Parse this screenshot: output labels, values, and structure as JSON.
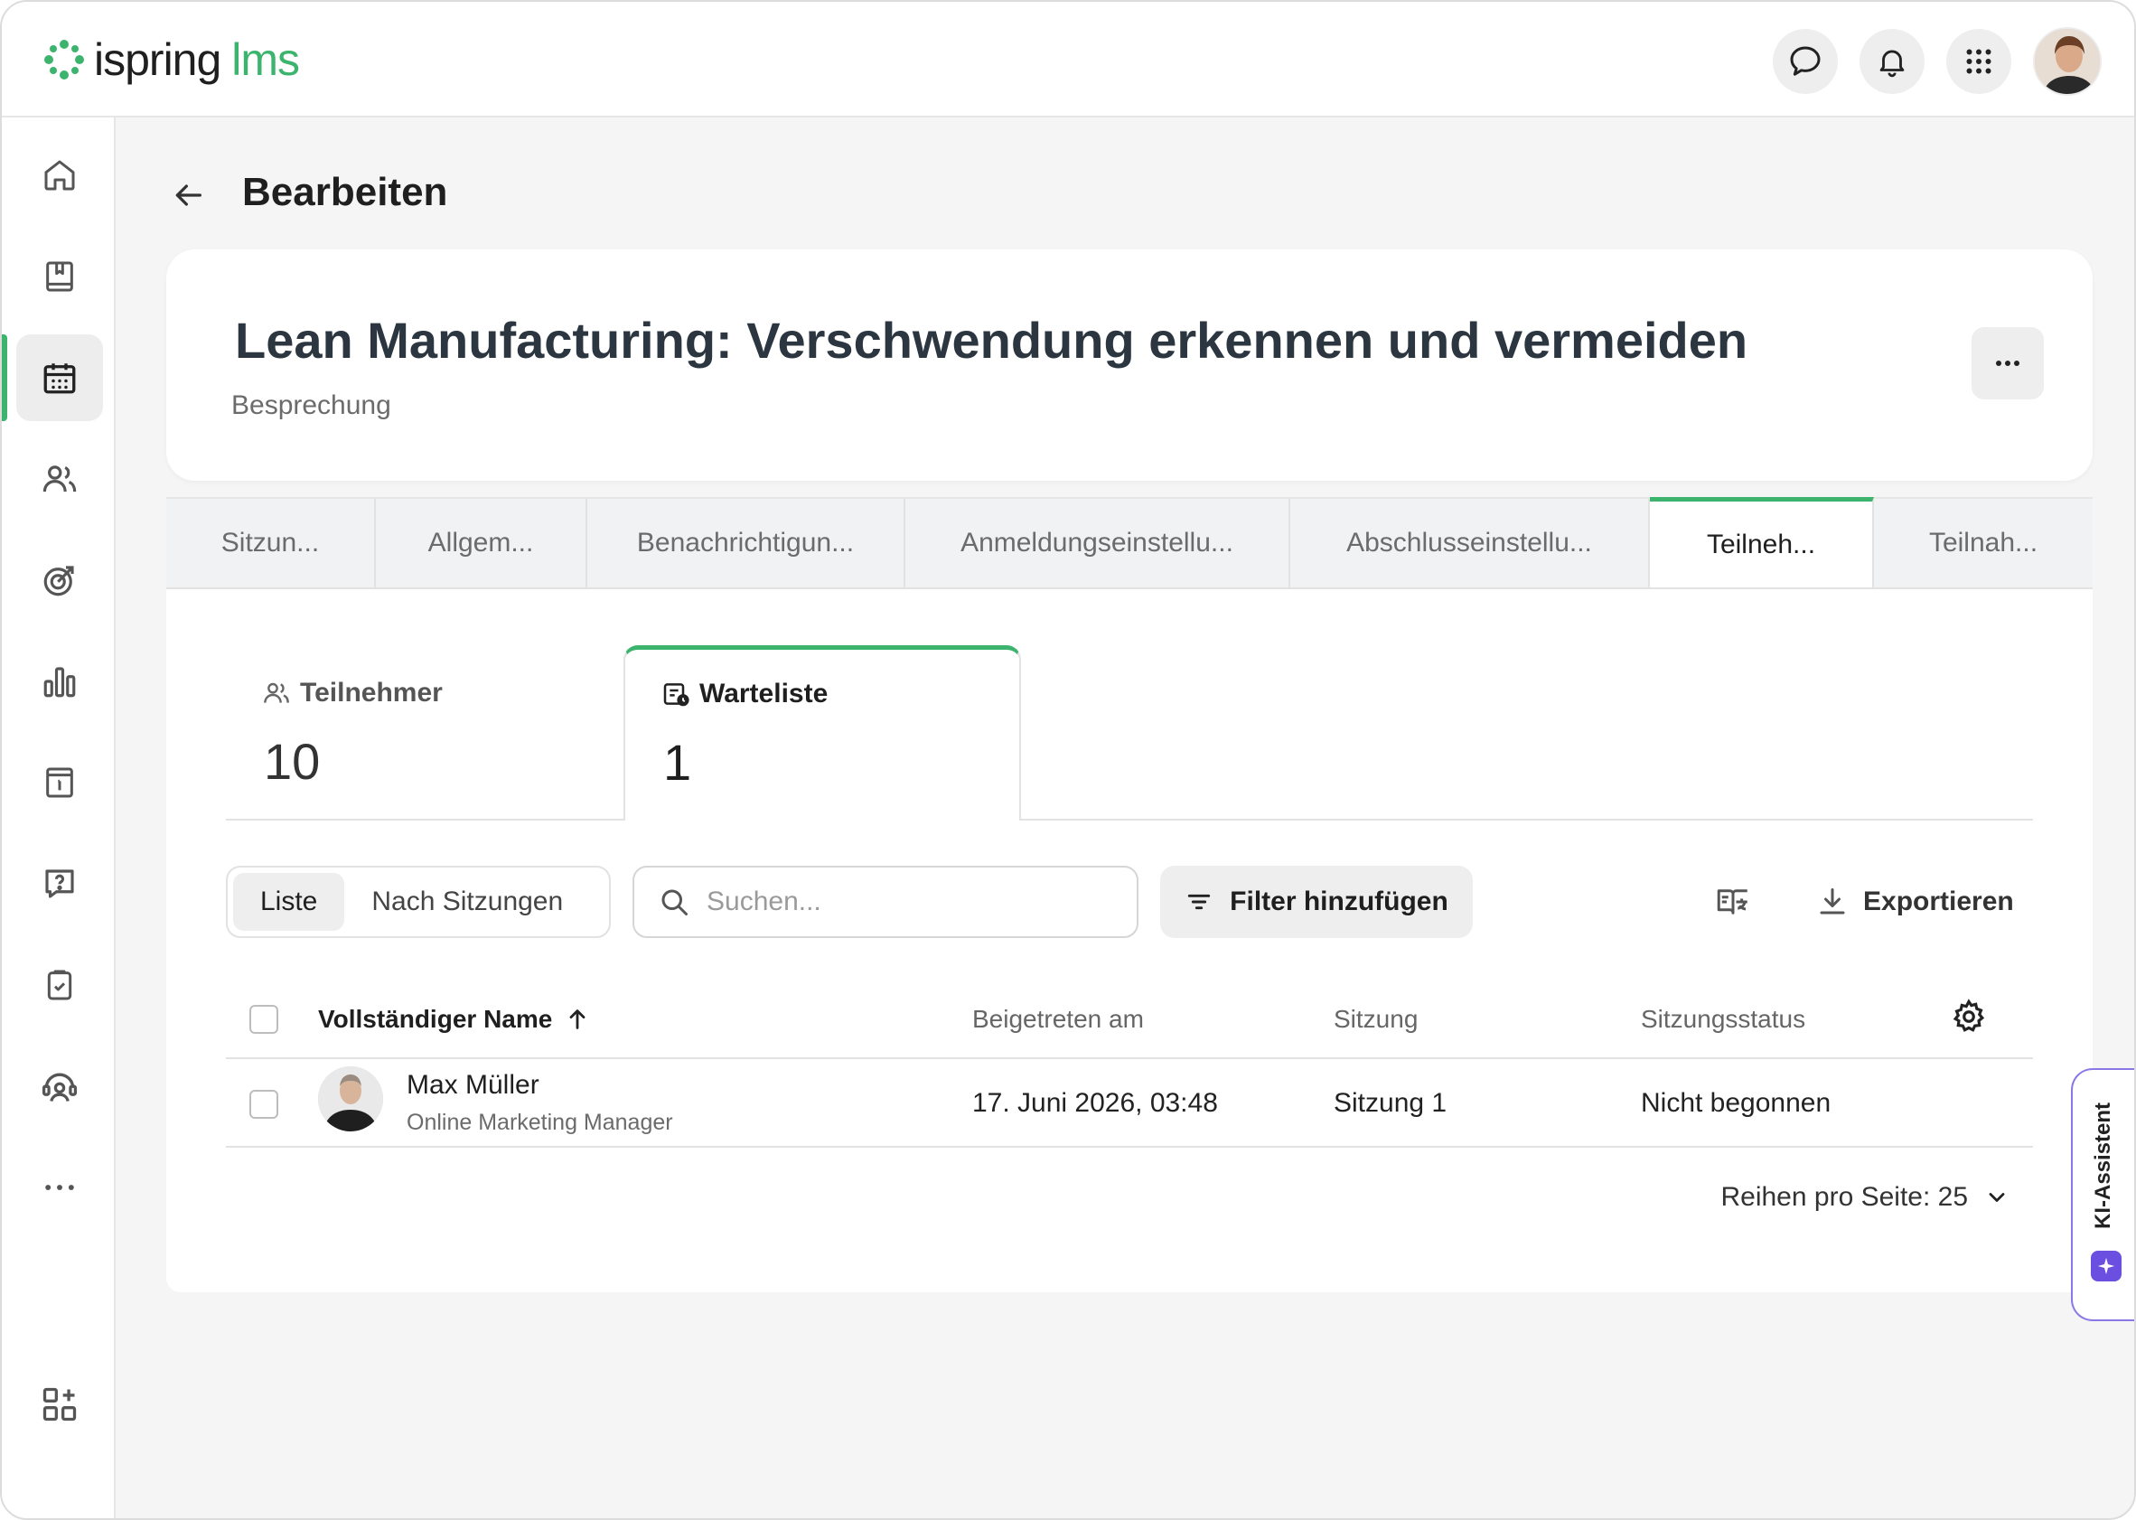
{
  "app": {
    "logo_text": "ispring",
    "logo_suffix": "lms",
    "accent": "#3cb46e"
  },
  "topbar": {
    "actions": [
      "chat-icon",
      "bell-icon",
      "apps-grid-icon",
      "user-avatar"
    ]
  },
  "rail": {
    "items": [
      {
        "icon": "home-icon",
        "active": false
      },
      {
        "icon": "book-icon",
        "active": false
      },
      {
        "icon": "calendar-icon",
        "active": true
      },
      {
        "icon": "users-icon",
        "active": false
      },
      {
        "icon": "target-icon",
        "active": false
      },
      {
        "icon": "chart-bars-icon",
        "active": false
      },
      {
        "icon": "info-board-icon",
        "active": false
      },
      {
        "icon": "help-chat-icon",
        "active": false
      },
      {
        "icon": "clipboard-check-icon",
        "active": false
      },
      {
        "icon": "headset-user-icon",
        "active": false
      },
      {
        "icon": "more-horizontal-icon",
        "active": false
      },
      {
        "icon": "add-widget-icon",
        "active": false
      }
    ]
  },
  "header": {
    "title": "Bearbeiten"
  },
  "card": {
    "title": "Lean Manufacturing: Verschwendung erkennen und vermeiden",
    "subtitle": "Besprechung"
  },
  "tabs": [
    {
      "label": "Sitzun...",
      "active": false
    },
    {
      "label": "Allgem...",
      "active": false
    },
    {
      "label": "Benachrichtigun...",
      "active": false
    },
    {
      "label": "Anmeldungseinstellu...",
      "active": false
    },
    {
      "label": "Abschlusseinstellu...",
      "active": false
    },
    {
      "label": "Teilneh...",
      "active": true
    },
    {
      "label": "Teilnah...",
      "active": false
    }
  ],
  "stats": {
    "participants": {
      "label": "Teilnehmer",
      "value": "10"
    },
    "waitlist": {
      "label": "Warteliste",
      "value": "1"
    }
  },
  "toolbar": {
    "view_list": "Liste",
    "view_sessions": "Nach Sitzungen",
    "search_placeholder": "Suchen...",
    "filter_label": "Filter hinzufügen",
    "export_label": "Exportieren"
  },
  "table": {
    "columns": [
      "Vollständiger Name",
      "Beigetreten am",
      "Sitzung",
      "Sitzungsstatus"
    ],
    "rows": [
      {
        "name": "Max Müller",
        "role": "Online Marketing Manager",
        "joined": "17. Juni 2026, 03:48",
        "session": "Sitzung 1",
        "status": "Nicht begonnen"
      }
    ]
  },
  "pager": {
    "label": "Reihen pro Seite: 25"
  },
  "ai": {
    "label": "KI-Assistent"
  }
}
